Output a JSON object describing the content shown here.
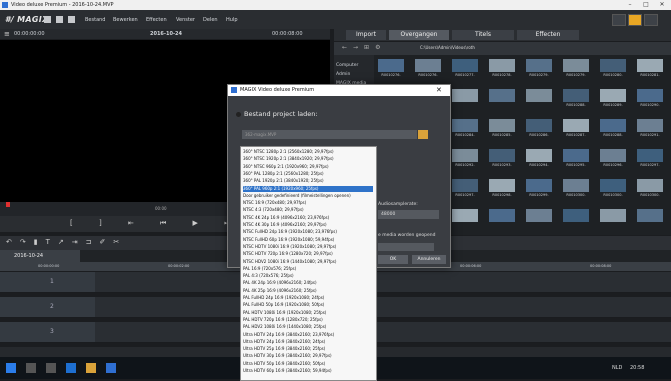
{
  "window": {
    "title": "Video deluxe Premium - 2016-10-24.MVP",
    "minimize": "–",
    "maximize": "□",
    "close": "✕"
  },
  "menubar": {
    "logo": "#/ MAGIX",
    "items": [
      "Bestand",
      "Bewerken",
      "Effecten",
      "Venster",
      "Delen",
      "Hulp"
    ]
  },
  "preview": {
    "timecode_left": "00:00:00:00",
    "date": "2016-10-24",
    "timecode_right": "00:00:08:00",
    "mini_time": "00:00"
  },
  "media_tabs": [
    "Import",
    "Overgangen",
    "Titels",
    "Effecten"
  ],
  "pathbar": {
    "path": "C:\\Users\\Admin\\Videos\\roth"
  },
  "tree": [
    "Computer",
    "Admin",
    "MAGIX media"
  ],
  "media_labels": [
    [
      "R0010276.",
      "R0010276.",
      "R0010277.",
      "R0010278.",
      "R0010279.",
      "R0010279.",
      "R0010280.",
      "R0010281."
    ],
    [
      "",
      "",
      "",
      "",
      "",
      "R0010288.",
      "R0010289.",
      "R0010290."
    ],
    [
      "R0010282.",
      "R0010283.",
      "R0010284.",
      "R0010285.",
      "R0010286.",
      "R0010287.",
      "R0010288.",
      "R0010291."
    ],
    [
      "R0010290.",
      "R0010291.",
      "R0010292.",
      "R0010293.",
      "R0010294.",
      "R0010295.",
      "R0010296.",
      "R0010297."
    ],
    [
      "R0010296.",
      "R0010296.",
      "R0010297.",
      "R0010298.",
      "R0010299.",
      "R0010300.",
      "R0010300.",
      "R0010300."
    ],
    [
      "R0010401.",
      "R0010401.",
      "",
      "",
      "",
      "",
      "",
      ""
    ]
  ],
  "dialog": {
    "title": "MAGIX Video deluxe Premium",
    "section_label": "Bestand project laden:",
    "field_value": "362-magix.MVP",
    "audio_label": "Audiosamplerate:",
    "audio_value": "48000",
    "media_note": "e media worden geopend",
    "ok_label": "OK",
    "cancel_label": "Annuleren"
  },
  "dropdown": {
    "selected_index": 5,
    "options": [
      "360° NTSC 1280p 2:1 (2560x1280; 29,97fps)",
      "360° NTSC 1920p 2:1 (3840x1920; 29,97fps)",
      "360° NTSC 960p 2:1 (1920x960; 29,97fps)",
      "360° PAL 1280p 2:1 (2560x1280; 25fps)",
      "360° PAL 1920p 2:1 (3840x1920; 25fps)",
      "360° PAL 960p 2:1 (1920x960; 25fps)",
      "Door gebruiker gedefinieerd (filmeistellingen openen)",
      "NTSC 16:9 (720x480; 29,97fps)",
      "NTSC 4:3 (720x480; 29,97fps)",
      "NTSC 4K 24p 16:9 (4096x2160; 23,976fps)",
      "NTSC 4K 30p 16:9 (4096x2160; 29,97fps)",
      "NTSC FullHD 24p 16:9 (1920x1080; 23,976fps)",
      "NTSC FullHD 60p 16:9 (1920x1080; 59,94fps)",
      "NTSC HDTV 1080i 16:9 (1920x1080; 29,97fps)",
      "NTSC HDTV 720p 16:9 (1280x720; 29,97fps)",
      "NTSC HDV2 1080i 16:9 (1440x1080; 29,97fps)",
      "PAL 16:9 (720x576; 25fps)",
      "PAL 4:3 (720x576; 25fps)",
      "PAL 4K 24p 16:9 (4096x2160; 24fps)",
      "PAL 4K 25p 16:9 (4096x2160; 25fps)",
      "PAL FullHD 24p 16:9 (1920x1080; 24fps)",
      "PAL FullHD 50p 16:9 (1920x1080; 50fps)",
      "PAL HDTV 1080i 16:9 (1920x1080; 25fps)",
      "PAL HDTV 720p 16:9 (1280x720; 25fps)",
      "PAL HDV2 1080i 16:9 (1440x1080; 25fps)",
      "Ultra HDTV 24p 16:9 (3840x2160; 23,976fps)",
      "Ultra HDTV 24p 16:9 (3840x2160; 24fps)",
      "Ultra HDTV 25p 16:9 (3840x2160; 25fps)",
      "Ultra HDTV 30p 16:9 (3840x2160; 29,97fps)",
      "Ultra HDTV 50p 16:9 (3840x2160; 50fps)",
      "Ultra HDTV 60p 16:9 (3840x2160; 59,94fps)"
    ]
  },
  "timeline": {
    "tab_label": "2016-10-24",
    "tracks": [
      "1",
      "2",
      "3"
    ],
    "ruler": [
      "00:00:00:00",
      "00:00:02:00",
      "00:00:04:00",
      "00:00:06:00",
      "00:00:08:00"
    ]
  },
  "taskbar": {
    "lang": "NLD",
    "time": "20:58"
  }
}
